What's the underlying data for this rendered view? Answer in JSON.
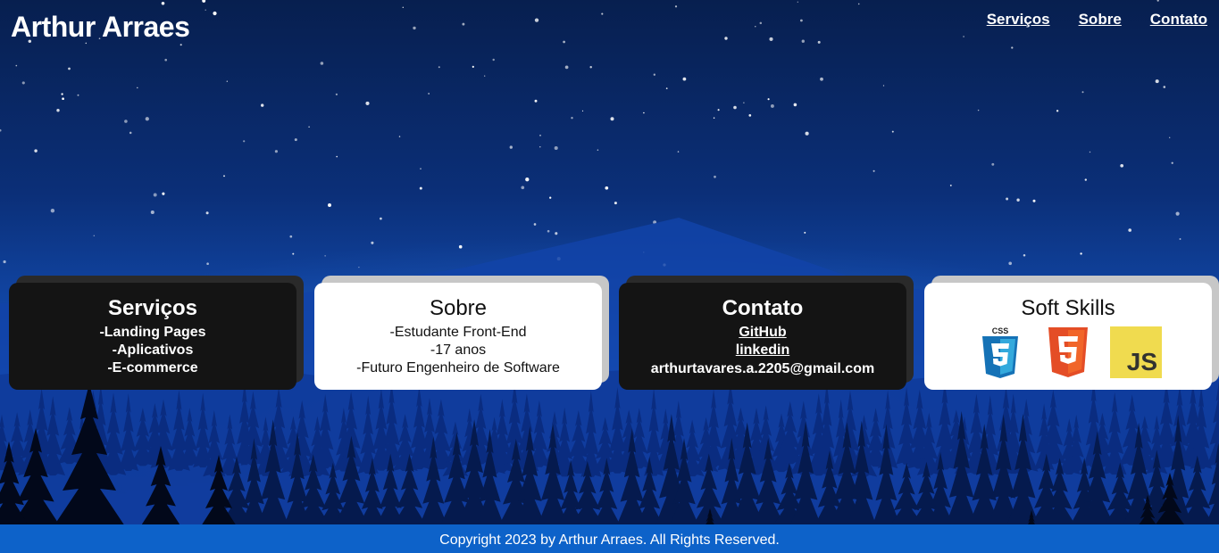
{
  "header": {
    "title": "Arthur Arraes",
    "nav": [
      "Serviços",
      "Sobre",
      "Contato"
    ]
  },
  "cards": {
    "servicos": {
      "title": "Serviços",
      "lines": [
        "-Landing Pages",
        "-Aplicativos",
        "-E-commerce"
      ]
    },
    "sobre": {
      "title": "Sobre",
      "lines": [
        "-Estudante Front-End",
        "-17 anos",
        "-Futuro Engenheiro de Software"
      ]
    },
    "contato": {
      "title": "Contato",
      "links": [
        "GitHub",
        "linkedin"
      ],
      "email": "arthurtavares.a.2205@gmail.com"
    },
    "skills": {
      "title": "Soft Skills",
      "icons": [
        "css3-icon",
        "html5-icon",
        "javascript-icon"
      ],
      "css_label": "CSS",
      "js_label": "JS"
    }
  },
  "footer": {
    "text": "Copyright 2023 by Arthur Arraes. All Rights Reserved."
  },
  "colors": {
    "sky_top": "#071f4f",
    "sky_bottom": "#1f78f0",
    "card_dark": "#141414",
    "card_light": "#ffffff",
    "footer": "#0d62c9"
  }
}
